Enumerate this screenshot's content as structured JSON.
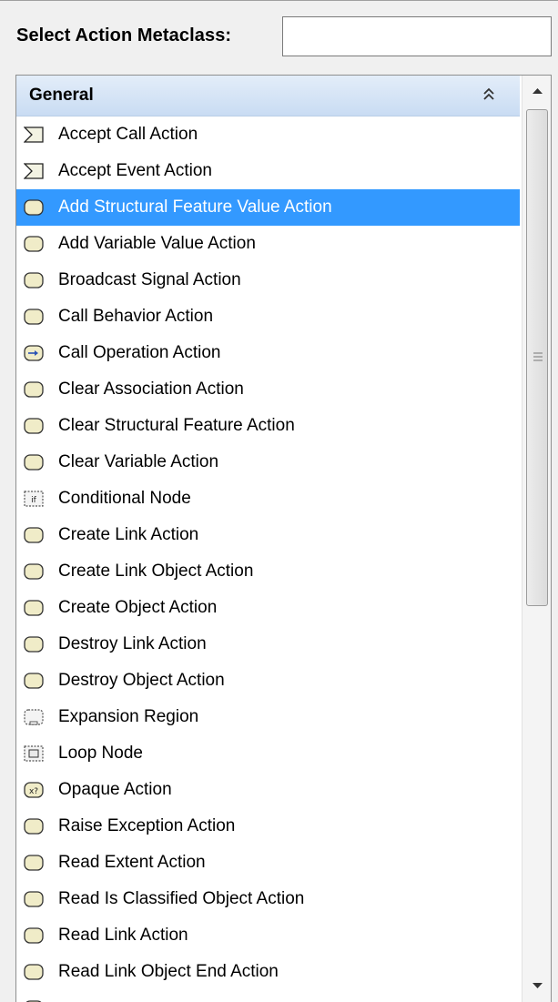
{
  "search": {
    "label": "Select Action Metaclass:",
    "value": "",
    "placeholder": ""
  },
  "group": {
    "title": "General"
  },
  "colors": {
    "selection": "#3399ff",
    "header": "#d6e4f6"
  },
  "items": [
    {
      "label": "Accept Call Action",
      "icon": "accept-action-icon"
    },
    {
      "label": "Accept Event Action",
      "icon": "accept-action-icon"
    },
    {
      "label": "Add Structural Feature Value Action",
      "icon": "action-icon",
      "selected": true
    },
    {
      "label": "Add Variable Value Action",
      "icon": "action-icon"
    },
    {
      "label": "Broadcast Signal Action",
      "icon": "action-icon"
    },
    {
      "label": "Call Behavior Action",
      "icon": "action-icon"
    },
    {
      "label": "Call Operation Action",
      "icon": "call-operation-icon"
    },
    {
      "label": "Clear Association Action",
      "icon": "action-icon"
    },
    {
      "label": "Clear Structural Feature Action",
      "icon": "action-icon"
    },
    {
      "label": "Clear Variable Action",
      "icon": "action-icon"
    },
    {
      "label": "Conditional Node",
      "icon": "conditional-node-icon"
    },
    {
      "label": "Create Link Action",
      "icon": "action-icon"
    },
    {
      "label": "Create Link Object Action",
      "icon": "action-icon"
    },
    {
      "label": "Create Object Action",
      "icon": "action-icon"
    },
    {
      "label": "Destroy Link Action",
      "icon": "action-icon"
    },
    {
      "label": "Destroy Object Action",
      "icon": "action-icon"
    },
    {
      "label": "Expansion Region",
      "icon": "expansion-region-icon"
    },
    {
      "label": "Loop Node",
      "icon": "loop-node-icon"
    },
    {
      "label": "Opaque Action",
      "icon": "opaque-action-icon"
    },
    {
      "label": "Raise Exception Action",
      "icon": "action-icon"
    },
    {
      "label": "Read Extent Action",
      "icon": "action-icon"
    },
    {
      "label": "Read Is Classified Object Action",
      "icon": "action-icon"
    },
    {
      "label": "Read Link Action",
      "icon": "action-icon"
    },
    {
      "label": "Read Link Object End Action",
      "icon": "action-icon"
    },
    {
      "label": "",
      "icon": "action-icon"
    }
  ]
}
